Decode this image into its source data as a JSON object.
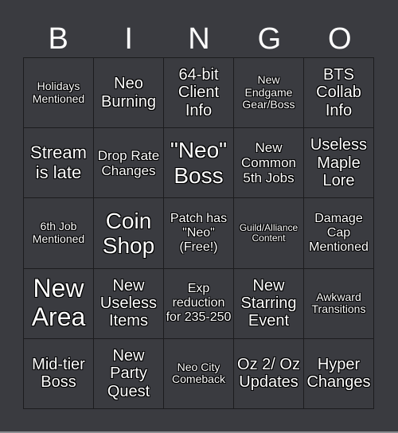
{
  "header": [
    "B",
    "I",
    "N",
    "G",
    "O"
  ],
  "cells": [
    [
      "Holidays Mentioned",
      "Neo Burning",
      "64-bit Client Info",
      "New Endgame Gear/Boss",
      "BTS Collab Info"
    ],
    [
      "Stream is late",
      "Drop Rate Changes",
      "\"Neo\" Boss",
      "New Common 5th Jobs",
      "Useless Maple Lore"
    ],
    [
      "6th Job Mentioned",
      "Coin Shop",
      "Patch has \"Neo\" (Free!)",
      "Guild/Alliance Content",
      "Damage Cap Mentioned"
    ],
    [
      "New Area",
      "New Useless Items",
      "Exp reduction for 235-250",
      "New Starring Event",
      "Awkward Transitions"
    ],
    [
      "Mid-tier Boss",
      "New Party Quest",
      "Neo City Comeback",
      "Oz 2/ Oz Updates",
      "Hyper Changes"
    ]
  ],
  "colors": {
    "background": "#3a3b40",
    "grid_line": "#1c1c1e",
    "text": "#ffffff"
  }
}
